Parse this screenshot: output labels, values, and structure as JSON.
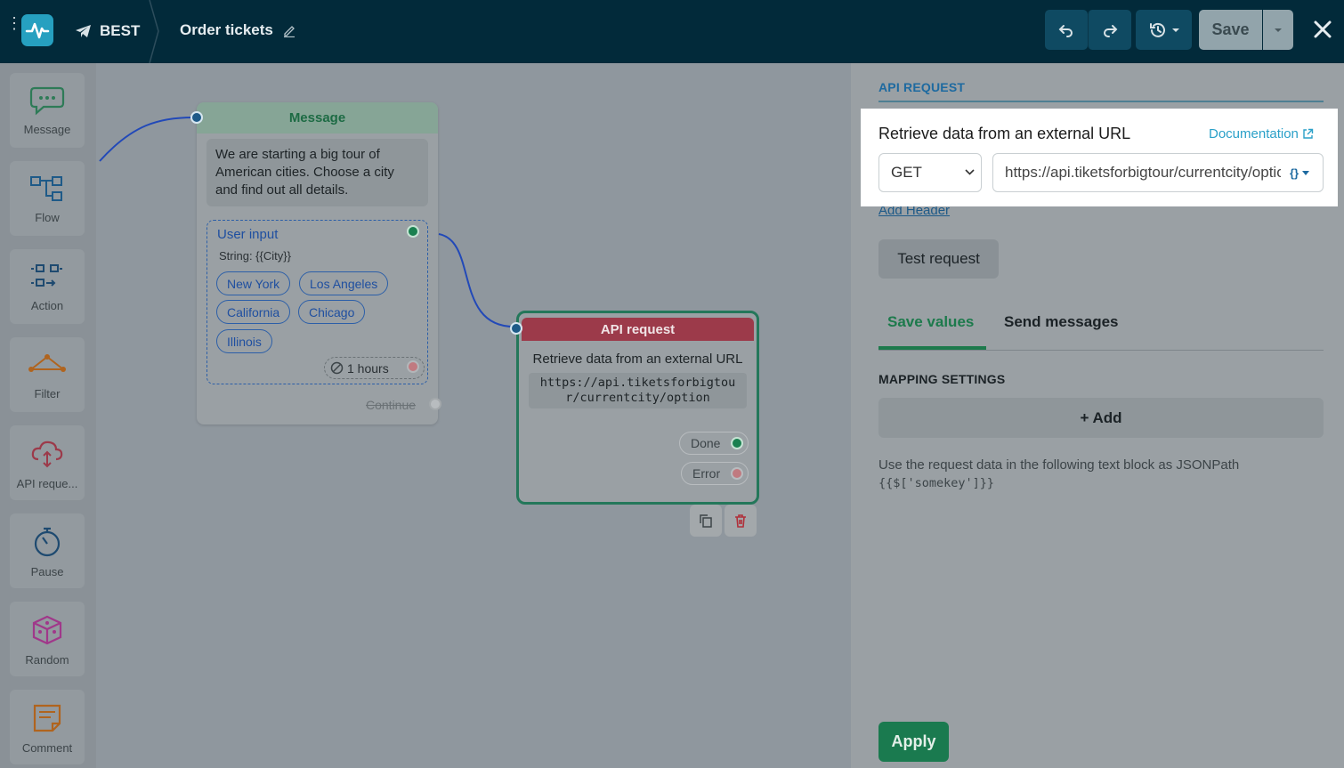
{
  "header": {
    "bot_name": "BEST",
    "flow_title": "Order tickets",
    "save_label": "Save",
    "colors": {
      "bar": "#022a3a",
      "logo": "#26a0c0"
    }
  },
  "sidebar": {
    "items": [
      {
        "label": "Message",
        "icon": "chat-bubble-icon"
      },
      {
        "label": "Flow",
        "icon": "flow-icon"
      },
      {
        "label": "Action",
        "icon": "action-icon"
      },
      {
        "label": "Filter",
        "icon": "filter-icon"
      },
      {
        "label": "API reque...",
        "icon": "cloud-api-icon"
      },
      {
        "label": "Pause",
        "icon": "stopwatch-icon"
      },
      {
        "label": "Random",
        "icon": "dice-icon"
      },
      {
        "label": "Comment",
        "icon": "comment-icon"
      }
    ]
  },
  "canvas": {
    "message_node": {
      "title": "Message",
      "text": "We are starting a big tour of American cities. Choose a city and find out all details.",
      "user_input": {
        "title": "User input",
        "type": "String: {{City}}",
        "options": [
          "New York",
          "Los Angeles",
          "California",
          "Chicago",
          "Illinois"
        ],
        "timeout": "1 hours"
      },
      "continue_label": "Continue"
    },
    "api_node": {
      "title": "API request",
      "description": "Retrieve data from an external URL",
      "url_line1": "https://api.tiketsforbigtou",
      "url_line2": "r/currentcity/option",
      "done_label": "Done",
      "error_label": "Error"
    }
  },
  "panel": {
    "title": "API REQUEST",
    "section_title": "Retrieve data from an external URL",
    "documentation_label": "Documentation",
    "method": "GET",
    "url": "https://api.tiketsforbigtour/currentcity/option",
    "add_header_label": "Add Header",
    "test_request_label": "Test request",
    "tabs": [
      {
        "label": "Save values",
        "active": true
      },
      {
        "label": "Send messages",
        "active": false
      }
    ],
    "mapping_title": "MAPPING SETTINGS",
    "add_label": "+ Add",
    "hint_text": "Use the request data in the following text block as JSONPath",
    "hint_code": "{{$['somekey']}}",
    "apply_label": "Apply"
  }
}
